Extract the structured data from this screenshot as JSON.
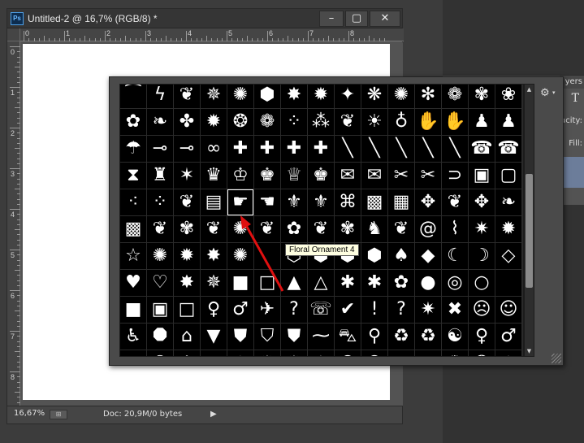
{
  "document": {
    "title": "Untitled-2 @ 16,7% (RGB/8) *",
    "app_icon": "Ps",
    "window_buttons": {
      "minimize": "–",
      "maximize": "▢",
      "close": "✕"
    },
    "ruler_h_numbers": [
      "0",
      "1",
      "2",
      "3",
      "4",
      "5",
      "6",
      "7",
      "8"
    ],
    "ruler_v_numbers": [
      "0",
      "1",
      "2",
      "3",
      "4",
      "5",
      "6",
      "7",
      "8"
    ],
    "status": {
      "zoom": "16,67%",
      "doc_info": "Doc: 20,9M/0 bytes",
      "arrow": "▶"
    }
  },
  "panels": {
    "layers_tab": "yers",
    "opacity_label": "acity:",
    "fill_label": "Fill:",
    "type_icon": "T"
  },
  "shape_picker": {
    "gear_icon": "⚙",
    "caret_icon": "▾",
    "scroll_up": "▲",
    "scroll_down": "▼",
    "tooltip": "Floral Ornament 4",
    "selected_index": 64,
    "cells": [
      {
        "g": "⁀",
        "n": "wave-top-shape"
      },
      {
        "g": "ϟ",
        "n": "lightning-shape"
      },
      {
        "g": "❦",
        "n": "floral-top-shape"
      },
      {
        "g": "✵",
        "n": "starburst-top-shape"
      },
      {
        "g": "✺",
        "n": "sun-top-shape"
      },
      {
        "g": "⬢",
        "n": "hexagon-top-shape"
      },
      {
        "g": "✸",
        "n": "star-top-shape"
      },
      {
        "g": "✹",
        "n": "burst-top-shape"
      },
      {
        "g": "✦",
        "n": "spark-top-shape"
      },
      {
        "g": "❋",
        "n": "flower-top-shape"
      },
      {
        "g": "✺",
        "n": "sun2-top-shape"
      },
      {
        "g": "✻",
        "n": "asterisk-top-shape"
      },
      {
        "g": "❁",
        "n": "blossom-top-shape"
      },
      {
        "g": "✾",
        "n": "rosette-top-shape"
      },
      {
        "g": "❀",
        "n": "flower2-top-shape"
      },
      {
        "g": "✿",
        "n": "leaf-sprig-shape"
      },
      {
        "g": "❧",
        "n": "leaf-branch-shape"
      },
      {
        "g": "✤",
        "n": "clover-shape"
      },
      {
        "g": "✹",
        "n": "sunburst-shape"
      },
      {
        "g": "❂",
        "n": "sun-flower-shape"
      },
      {
        "g": "❁",
        "n": "daisy-shape"
      },
      {
        "g": "⁘",
        "n": "dots-shape"
      },
      {
        "g": "⁂",
        "n": "grass-shape"
      },
      {
        "g": "❦",
        "n": "leaves-shape"
      },
      {
        "g": "☀",
        "n": "bulb-shape"
      },
      {
        "g": "♁",
        "n": "bulb-outline-shape"
      },
      {
        "g": "✋",
        "n": "hand-shape"
      },
      {
        "g": "✋",
        "n": "hand-outline-shape"
      },
      {
        "g": "♟",
        "n": "foot-shape"
      },
      {
        "g": "♟",
        "n": "footprint-shape"
      },
      {
        "g": "☂",
        "n": "umbrella-shape"
      },
      {
        "g": "⊸",
        "n": "key-shape"
      },
      {
        "g": "⊸",
        "n": "key2-shape"
      },
      {
        "g": "∞",
        "n": "bow-shape"
      },
      {
        "g": "✚",
        "n": "puzzle-shape"
      },
      {
        "g": "✚",
        "n": "puzzle2-shape"
      },
      {
        "g": "✚",
        "n": "puzzle3-shape"
      },
      {
        "g": "✚",
        "n": "puzzle4-shape"
      },
      {
        "g": "╲",
        "n": "stick-shape"
      },
      {
        "g": "╲",
        "n": "stick2-shape"
      },
      {
        "g": "╲",
        "n": "pencil-shape"
      },
      {
        "g": "╲",
        "n": "pencil2-shape"
      },
      {
        "g": "╲",
        "n": "pen-shape"
      },
      {
        "g": "☎",
        "n": "phone-shape"
      },
      {
        "g": "☎",
        "n": "phone2-shape"
      },
      {
        "g": "⧗",
        "n": "hourglass-shape"
      },
      {
        "g": "♜",
        "n": "pin-shape"
      },
      {
        "g": "✶",
        "n": "star-badge-shape"
      },
      {
        "g": "♛",
        "n": "crown-shape"
      },
      {
        "g": "♔",
        "n": "crown2-shape"
      },
      {
        "g": "♚",
        "n": "crown3-shape"
      },
      {
        "g": "♕",
        "n": "crown4-shape"
      },
      {
        "g": "♚",
        "n": "crown5-shape"
      },
      {
        "g": "✉",
        "n": "envelope-shape"
      },
      {
        "g": "✉",
        "n": "envelope2-shape"
      },
      {
        "g": "✂",
        "n": "scissors-shape"
      },
      {
        "g": "✂",
        "n": "scissors2-shape"
      },
      {
        "g": "⊃",
        "n": "paperclip-shape"
      },
      {
        "g": "▣",
        "n": "stamp-shape"
      },
      {
        "g": "▢",
        "n": "stamp2-shape"
      },
      {
        "g": "⁖",
        "n": "splatter-shape"
      },
      {
        "g": "⁘",
        "n": "splatter2-shape"
      },
      {
        "g": "❦",
        "n": "floral-ornament-1-shape"
      },
      {
        "g": "▤",
        "n": "flag-shape"
      },
      {
        "g": "☛",
        "n": "pointing-hand-shape"
      },
      {
        "g": "☚",
        "n": "pointing-hand2-shape"
      },
      {
        "g": "⚜",
        "n": "fleur-de-lis-shape"
      },
      {
        "g": "⚜",
        "n": "fleur-de-lis2-shape"
      },
      {
        "g": "⌘",
        "n": "ornament-frame-shape"
      },
      {
        "g": "▩",
        "n": "ornament-tile-shape"
      },
      {
        "g": "▦",
        "n": "ornament-tile2-shape"
      },
      {
        "g": "✥",
        "n": "ornament-cross-shape"
      },
      {
        "g": "❦",
        "n": "ornament-scroll-shape"
      },
      {
        "g": "✥",
        "n": "ornament-diamond-shape"
      },
      {
        "g": "❧",
        "n": "ornament-leaf-shape"
      },
      {
        "g": "▩",
        "n": "ornament-square-shape"
      },
      {
        "g": "❦",
        "n": "floral-swirl-shape"
      },
      {
        "g": "✾",
        "n": "floral-ornament-2-shape"
      },
      {
        "g": "❦",
        "n": "floral-ornament-3-shape"
      },
      {
        "g": "✺",
        "n": "floral-ornament-4-shape"
      },
      {
        "g": "❦",
        "n": "floral-ornament-5-shape"
      },
      {
        "g": "✿",
        "n": "flower-5-shape"
      },
      {
        "g": "❦",
        "n": "heart-leaf-shape"
      },
      {
        "g": "✾",
        "n": "bird-shape"
      },
      {
        "g": "♞",
        "n": "bird2-shape"
      },
      {
        "g": "❦",
        "n": "flourish-shape"
      },
      {
        "g": "@",
        "n": "spiral-shape"
      },
      {
        "g": "⌇",
        "n": "zigzag-shape"
      },
      {
        "g": "✷",
        "n": "burst-shape"
      },
      {
        "g": "✹",
        "n": "burst2-shape"
      },
      {
        "g": "☆",
        "n": "star-outline-shape"
      },
      {
        "g": "✺",
        "n": "seal-shape"
      },
      {
        "g": "✹",
        "n": "seal2-shape"
      },
      {
        "g": "✸",
        "n": "starburst-shape"
      },
      {
        "g": "✺",
        "n": "starburst2-shape"
      },
      {
        "g": "",
        "n": "empty-cell"
      },
      {
        "g": "⬡",
        "n": "hexagon-outline-shape"
      },
      {
        "g": "⬢",
        "n": "bubble-shape"
      },
      {
        "g": "⬢",
        "n": "bubble2-shape"
      },
      {
        "g": "⬢",
        "n": "bubble3-shape"
      },
      {
        "g": "♠",
        "n": "spade-shape"
      },
      {
        "g": "◆",
        "n": "diamond-shape"
      },
      {
        "g": "☾",
        "n": "moon-shape"
      },
      {
        "g": "☽",
        "n": "moon-outline-shape"
      },
      {
        "g": "◇",
        "n": "diamond-outline-shape"
      },
      {
        "g": "♥",
        "n": "heart-shape"
      },
      {
        "g": "♡",
        "n": "heart-outline-shape"
      },
      {
        "g": "✸",
        "n": "octagram-shape"
      },
      {
        "g": "✵",
        "n": "octagram-outline-shape"
      },
      {
        "g": "■",
        "n": "rounded-square-shape"
      },
      {
        "g": "□",
        "n": "rounded-square-outline-shape"
      },
      {
        "g": "▲",
        "n": "triangle-shape"
      },
      {
        "g": "△",
        "n": "triangle-outline-shape"
      },
      {
        "g": "✱",
        "n": "blob-shape"
      },
      {
        "g": "✱",
        "n": "asterisk-shape"
      },
      {
        "g": "✿",
        "n": "flower-outline-shape"
      },
      {
        "g": "●",
        "n": "circle-shape"
      },
      {
        "g": "◎",
        "n": "circle-frame-shape"
      },
      {
        "g": "○",
        "n": "circle-outline-shape"
      },
      {
        "g": "",
        "n": "empty-cell-2"
      },
      {
        "g": "■",
        "n": "square-shape"
      },
      {
        "g": "▣",
        "n": "square-frame-shape"
      },
      {
        "g": "□",
        "n": "square-outline-shape"
      },
      {
        "g": "♀",
        "n": "woman-shape"
      },
      {
        "g": "♂",
        "n": "man-shape"
      },
      {
        "g": "✈",
        "n": "airplane-shape"
      },
      {
        "g": "?",
        "n": "question-box-shape"
      },
      {
        "g": "☏",
        "n": "phone-box-shape"
      },
      {
        "g": "✔",
        "n": "checkmark-shape"
      },
      {
        "g": "!",
        "n": "exclamation-shape"
      },
      {
        "g": "?",
        "n": "question-shape"
      },
      {
        "g": "✷",
        "n": "explosion-shape"
      },
      {
        "g": "✖",
        "n": "x-shape"
      },
      {
        "g": "☹",
        "n": "pedestrian-shape"
      },
      {
        "g": "☺",
        "n": "people-shape"
      },
      {
        "g": "♿",
        "n": "wheelchair-shape"
      },
      {
        "g": "⯃",
        "n": "stop-sign-shape"
      },
      {
        "g": "⌂",
        "n": "house-shape"
      },
      {
        "g": "▼",
        "n": "yield-shape"
      },
      {
        "g": "⛊",
        "n": "shield-shape"
      },
      {
        "g": "⛉",
        "n": "shield2-shape"
      },
      {
        "g": "⛊",
        "n": "shield3-shape"
      },
      {
        "g": "⁓",
        "n": "tilde-shape"
      },
      {
        "g": "⛍",
        "n": "car-shape"
      },
      {
        "g": "⚲",
        "n": "bicycle-shape"
      },
      {
        "g": "♻",
        "n": "recycle-outline-shape"
      },
      {
        "g": "♻",
        "n": "recycle-shape"
      },
      {
        "g": "☯",
        "n": "yin-yang-shape"
      },
      {
        "g": "♀",
        "n": "female-symbol-shape"
      },
      {
        "g": "♂",
        "n": "male-symbol-shape"
      },
      {
        "g": "◎",
        "n": "target-shape"
      },
      {
        "g": "☢",
        "n": "radiation-shape"
      },
      {
        "g": "⚛",
        "n": "atom-shape"
      },
      {
        "g": "⊕",
        "n": "globe-shape"
      },
      {
        "g": "✧",
        "n": "compass-shape"
      },
      {
        "g": "✹",
        "n": "blast-shape"
      },
      {
        "g": "✹",
        "n": "blast2-shape"
      },
      {
        "g": "✶",
        "n": "compass-star-shape"
      },
      {
        "g": "©",
        "n": "copyright-shape"
      },
      {
        "g": "®",
        "n": "registered-shape"
      },
      {
        "g": "TM",
        "n": "trademark-shape"
      },
      {
        "g": "⌖",
        "n": "crosshair-shape"
      },
      {
        "g": "✺",
        "n": "sunrays-shape"
      },
      {
        "g": "❂",
        "n": "sunrays2-shape"
      },
      {
        "g": "♨",
        "n": "flame-shape"
      }
    ]
  }
}
